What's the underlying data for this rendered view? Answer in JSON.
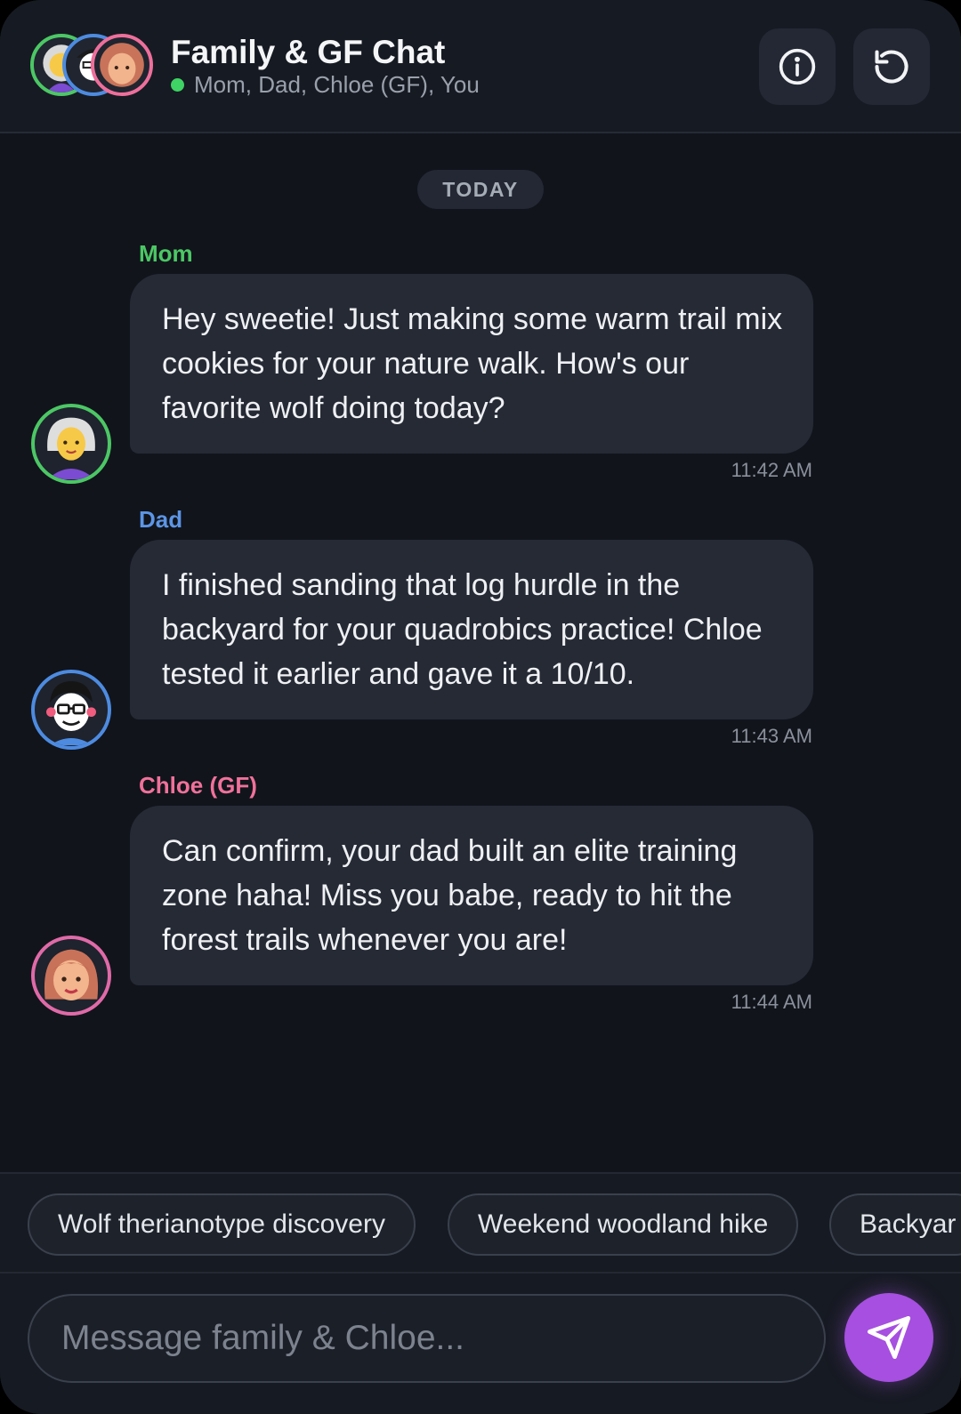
{
  "header": {
    "title": "Family & GF Chat",
    "members": "Mom, Dad, Chloe (GF), You",
    "status_color": "#3fd264",
    "info_icon": "info-icon",
    "reset_icon": "refresh-icon"
  },
  "chat": {
    "date_divider": "TODAY",
    "messages": [
      {
        "sender": "Mom",
        "sender_color": "#4cc765",
        "text": "Hey sweetie! Just making some warm trail mix cookies for your nature walk. How's our favorite wolf doing today?",
        "time": "11:42 AM"
      },
      {
        "sender": "Dad",
        "sender_color": "#5c95e6",
        "text": "I finished sanding that log hurdle in the backyard for your quadrobics practice! Chloe tested it earlier and gave it a 10/10.",
        "time": "11:43 AM"
      },
      {
        "sender": "Chloe (GF)",
        "sender_color": "#f0719a",
        "text": "Can confirm, your dad built an elite training zone haha! Miss you babe, ready to hit the forest trails whenever you are!",
        "time": "11:44 AM"
      }
    ]
  },
  "suggestions": [
    "Wolf therianotype discovery",
    "Weekend woodland hike",
    "Backyar"
  ],
  "composer": {
    "placeholder": "Message family & Chloe...",
    "value": "",
    "accent": "#a64fe0"
  }
}
